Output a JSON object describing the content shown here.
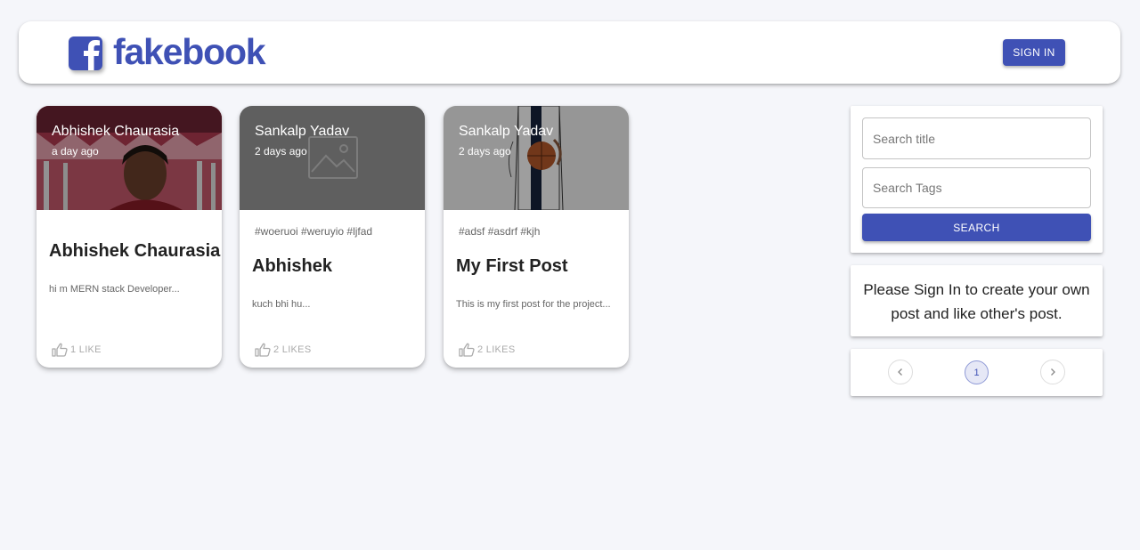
{
  "header": {
    "brand": "fakebook",
    "logo_icon": "facebook-f-icon",
    "signin_label": "SIGN IN",
    "accent_color": "#3f51b5"
  },
  "posts": [
    {
      "author": "Abhishek Chaurasia",
      "time": "a day ago",
      "tags": "",
      "title": "Abhishek Chaurasia",
      "message": "hi m MERN stack Developer...",
      "likes": "1 LIKE",
      "image": "selfie-photo"
    },
    {
      "author": "Sankalp Yadav",
      "time": "2 days ago",
      "tags": "#woeruoi #weruyio #ljfad",
      "title": "Abhishek",
      "message": "kuch bhi hu...",
      "likes": "2 LIKES",
      "image": "placeholder-image-icon"
    },
    {
      "author": "Sankalp Yadav",
      "time": "2 days ago",
      "tags": "#adsf #asdrf #kjh",
      "title": "My First Post",
      "message": "This is my first post for the project...",
      "likes": "2 LIKES",
      "image": "basketball-player-drawing"
    }
  ],
  "search": {
    "title_placeholder": "Search title",
    "tags_placeholder": "Search Tags",
    "button_label": "SEARCH"
  },
  "signin_note": "Please Sign In to create your own post and like other's post.",
  "pagination": {
    "prev_icon": "chevron-left-icon",
    "current_page": "1",
    "next_icon": "chevron-right-icon"
  }
}
